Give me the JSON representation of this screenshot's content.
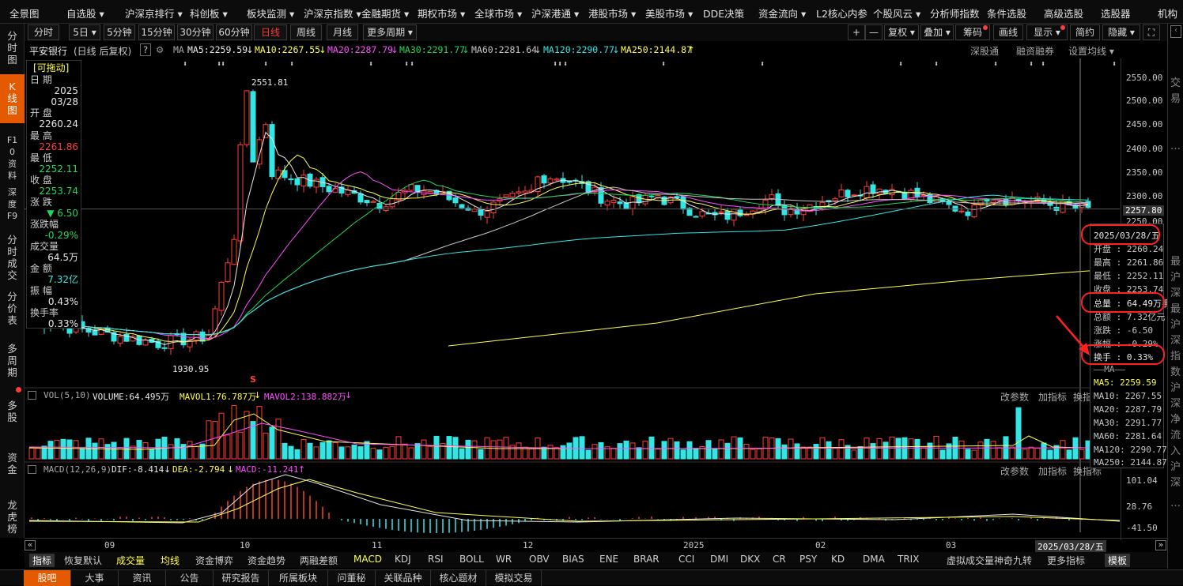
{
  "topnav": [
    "全景图",
    "自选股 ▾",
    "沪深京排行 ▾",
    "科创板 ▾",
    "板块监测 ▾",
    "沪深京指数 ▾",
    "金融期货 ▾",
    "期权市场 ▾",
    "全球市场 ▾",
    "沪深港通 ▾",
    "港股市场 ▾",
    "美股市场 ▾",
    "DDE决策",
    "资金流向 ▾",
    "L2核心内参",
    "个股风云 ▾",
    "分析师指数",
    "条件选股",
    "高级选股",
    "选股器",
    "机构"
  ],
  "left_tabs": [
    "分时图",
    "K线图",
    "F10资料",
    "深度F9",
    "分时成交",
    "分价表",
    "多周期",
    "多股",
    "资金",
    "龙虎榜"
  ],
  "periods": [
    "分时",
    "5日 ▾",
    "5分钟",
    "15分钟",
    "30分钟",
    "60分钟",
    "日线",
    "周线",
    "月线",
    "更多周期 ▾"
  ],
  "active_period": "日线",
  "toolbar_right": [
    "+",
    "—",
    "复权 ▾",
    "叠加 ▾",
    "筹码",
    "画线",
    "显示 ▾",
    "简约",
    "隐藏 ▾",
    "⛶"
  ],
  "stock": {
    "name": "平安银行",
    "mode": "(日线 后复权)"
  },
  "ma_bar": {
    "label": "MA",
    "items": [
      {
        "text": "MA5:2259.59",
        "arrow": "↓",
        "color": "#e8e8e8"
      },
      {
        "text": "MA10:2267.55",
        "arrow": "↓",
        "color": "#ffff4a"
      },
      {
        "text": "MA20:2287.79",
        "arrow": "↓",
        "color": "#ff4cff"
      },
      {
        "text": "MA30:2291.77",
        "arrow": "↓",
        "color": "#1fd75b"
      },
      {
        "text": "MA60:2281.64",
        "arrow": "↓",
        "color": "#c8c8c8"
      },
      {
        "text": "MA120:2290.77",
        "arrow": "↓",
        "color": "#32e6e6"
      },
      {
        "text": "MA250:2144.87",
        "arrow": "↑",
        "color": "#ffff4a"
      }
    ],
    "right": [
      "深股通",
      "融资融券",
      "设置均线 ▾"
    ]
  },
  "info": {
    "drag": "[可拖动]",
    "date_label": "日 期",
    "date_year": "2025",
    "date_md": "03/28",
    "open_label": "开 盘",
    "open": "2260.24",
    "high_label": "最 高",
    "high": "2261.86",
    "low_label": "最 低",
    "low": "2252.11",
    "close_label": "收 盘",
    "close": "2253.74",
    "chg_label": "涨 跌",
    "chg": "▼ 6.50",
    "pct_label": "涨跌幅",
    "pct": "-0.29%",
    "vol_label": "成交量",
    "vol": "64.5万",
    "amt_label": "金 额",
    "amt": "7.32亿",
    "amp_label": "振 幅",
    "amp": "0.43%",
    "turn_label": "换手率",
    "turn": "0.33%"
  },
  "price_axis": [
    "2550.00",
    "2500.00",
    "2450.00",
    "2400.00",
    "2350.00",
    "2300.00",
    "2257.80",
    "2250.00"
  ],
  "chart_annotations": {
    "high": "2551.81",
    "low": "1930.95",
    "marker": "S"
  },
  "popup": {
    "date": "2025/03/28/五",
    "open": "开盘 : 2260.24",
    "high": "最高 : 2261.86",
    "low": "最低 : 2252.11",
    "close": "收盘 : 2253.74",
    "vol": "总量 : 64.49万手",
    "amt": "总额 : 7.32亿元",
    "chg": "涨跌 : -6.50",
    "pct": "涨幅 : -0.29%",
    "turn": "换手 : 0.33%",
    "ma_title": "——MA——",
    "ma5": "MA5: 2259.59",
    "ma10": "MA10: 2267.55",
    "ma20": "MA20: 2287.79",
    "ma30": "MA30: 2291.77",
    "ma60": "MA60: 2281.64",
    "ma120": "MA120: 2290.77",
    "ma250": "MA250: 2144.87"
  },
  "vol_bar": {
    "label": "VOL(5,10)",
    "volume": "VOLUME:64.495万",
    "mavol1": "MAVOL1:76.787万",
    "mavol1_arrow": "↓",
    "mavol2": "MAVOL2:138.882万",
    "mavol2_arrow": "↓",
    "right": [
      "改参数",
      "加指标",
      "换指"
    ]
  },
  "macd_bar": {
    "label": "MACD(12,26,9)",
    "dif": "DIF:-8.414",
    "dif_arrow": "↓",
    "dea": "DEA:-2.794",
    "dea_arrow": "↓",
    "macd": "MACD:-11.241",
    "macd_arrow": "↑",
    "right": [
      "改参数",
      "加指标",
      "换指标"
    ]
  },
  "macd_axis": [
    "101.04",
    "28.76",
    "-41.50"
  ],
  "x_axis": [
    "09",
    "10",
    "11",
    "12",
    "2025",
    "02",
    "03"
  ],
  "cursor_date": "2025/03/28/五",
  "indicator_tabs": [
    "指标",
    "恢复默认",
    "成交量",
    "均线",
    "资金博弈",
    "资金趋势",
    "两融差额",
    "MACD",
    "KDJ",
    "RSI",
    "BOLL",
    "WR",
    "OBV",
    "BIAS",
    "ENE",
    "BRAR",
    "CCI",
    "DMI",
    "DKX",
    "CR",
    "PSY",
    "KD",
    "DMA",
    "TRIX",
    "虚拟成交量",
    "神奇九转",
    "更多指标",
    "模板"
  ],
  "bottom_tabs": [
    "股吧",
    "大事",
    "资讯",
    "公告",
    "研究报告",
    "所属板块",
    "问董秘",
    "关联品种",
    "核心题材",
    "模拟交易"
  ],
  "right_edge": [
    "交",
    "易",
    "…",
    "最",
    "沪",
    "深",
    "最",
    "沪",
    "深",
    "指",
    "数",
    "沪",
    "深",
    "净",
    "流",
    "入",
    "沪",
    "深",
    "…"
  ]
}
